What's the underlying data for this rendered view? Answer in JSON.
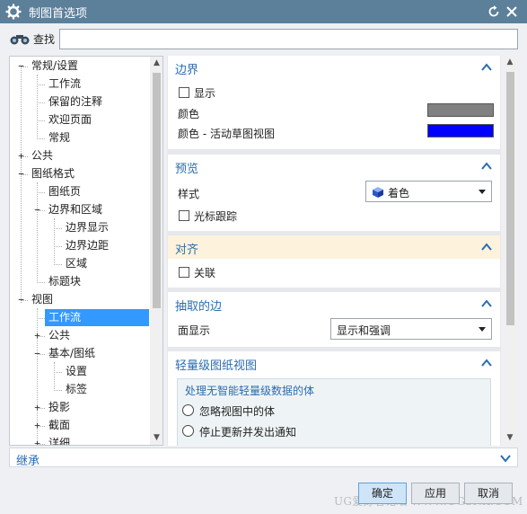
{
  "window": {
    "title": "制图首选项",
    "gear_icon": "gear-icon",
    "reset_icon": "reset-icon",
    "close_icon": "close-icon"
  },
  "search": {
    "label": "查找",
    "value": "",
    "icon": "binoculars-icon"
  },
  "tree": {
    "items": [
      {
        "label": "常规/设置",
        "level": 0,
        "expander": "−"
      },
      {
        "label": "工作流",
        "level": 1,
        "expander": ""
      },
      {
        "label": "保留的注释",
        "level": 1,
        "expander": ""
      },
      {
        "label": "欢迎页面",
        "level": 1,
        "expander": ""
      },
      {
        "label": "常规",
        "level": 1,
        "expander": ""
      },
      {
        "label": "公共",
        "level": 0,
        "expander": "+"
      },
      {
        "label": "图纸格式",
        "level": 0,
        "expander": "−"
      },
      {
        "label": "图纸页",
        "level": 1,
        "expander": ""
      },
      {
        "label": "边界和区域",
        "level": 1,
        "expander": "−"
      },
      {
        "label": "边界显示",
        "level": 2,
        "expander": ""
      },
      {
        "label": "边界边距",
        "level": 2,
        "expander": ""
      },
      {
        "label": "区域",
        "level": 2,
        "expander": ""
      },
      {
        "label": "标题块",
        "level": 1,
        "expander": ""
      },
      {
        "label": "视图",
        "level": 0,
        "expander": "−"
      },
      {
        "label": "工作流",
        "level": 1,
        "expander": "",
        "selected": true
      },
      {
        "label": "公共",
        "level": 1,
        "expander": "+"
      },
      {
        "label": "基本/图纸",
        "level": 1,
        "expander": "−"
      },
      {
        "label": "设置",
        "level": 2,
        "expander": ""
      },
      {
        "label": "标签",
        "level": 2,
        "expander": ""
      },
      {
        "label": "投影",
        "level": 1,
        "expander": "+"
      },
      {
        "label": "截面",
        "level": 1,
        "expander": "+"
      },
      {
        "label": "详细",
        "level": 1,
        "expander": "+"
      }
    ]
  },
  "sections": {
    "border": {
      "title": "边界",
      "display_label": "显示",
      "color_label": "颜色",
      "color_value": "#808080",
      "active_color_label": "颜色 - 活动草图视图",
      "active_color_value": "#0000ff"
    },
    "preview": {
      "title": "预览",
      "style_label": "样式",
      "style_value": "着色",
      "cursor_track_label": "光标跟踪"
    },
    "align": {
      "title": "对齐",
      "associate_label": "关联"
    },
    "extracted": {
      "title": "抽取的边",
      "face_display_label": "面显示",
      "face_display_value": "显示和强调"
    },
    "lightweight": {
      "title": "轻量级图纸视图",
      "group_title": "处理无智能轻量级数据的体",
      "option1": "忽略视图中的体",
      "option2": "停止更新并发出通知"
    }
  },
  "inherit": {
    "title": "继承"
  },
  "buttons": {
    "ok": "确定",
    "apply": "应用",
    "cancel": "取消"
  },
  "watermark": "UG爱好者论坛  WWW.UGSNX.COM"
}
